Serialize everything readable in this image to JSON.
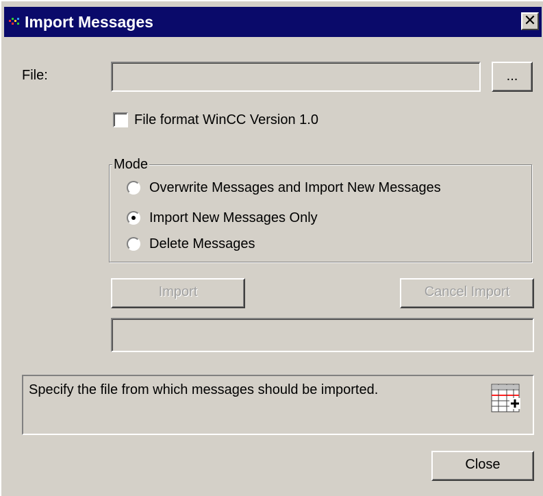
{
  "window": {
    "title": "Import Messages",
    "close_glyph": "✕",
    "icon": "wincc-app-icon",
    "title_bar_color": "#0a0a6a"
  },
  "file": {
    "label": "File:",
    "value": "",
    "browse_label": "..."
  },
  "format_option": {
    "label": "File format  WinCC Version 1.0",
    "checked": false
  },
  "mode": {
    "legend": "Mode",
    "options": [
      {
        "label": "Overwrite Messages and Import New Messages",
        "checked": false
      },
      {
        "label": "Import New Messages Only",
        "checked": true
      },
      {
        "label": "Delete Messages",
        "checked": false
      }
    ]
  },
  "actions": {
    "import_label": "Import",
    "cancel_label": "Cancel Import"
  },
  "progress": {
    "value": ""
  },
  "info": {
    "text": "Specify the file from which messages should be imported.",
    "icon": "message-list-icon"
  },
  "footer": {
    "close_label": "Close"
  }
}
